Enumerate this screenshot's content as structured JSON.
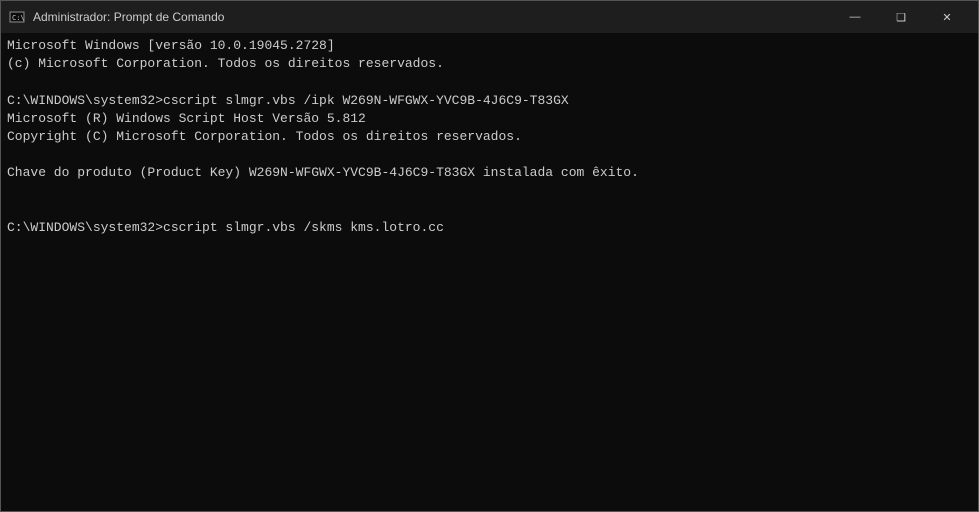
{
  "window": {
    "title": "Administrador: Prompt de Comando"
  },
  "titlebar": {
    "minimize_label": "—",
    "maximize_label": "❑",
    "close_label": "✕"
  },
  "console": {
    "lines": [
      "Microsoft Windows [versão 10.0.19045.2728]",
      "(c) Microsoft Corporation. Todos os direitos reservados.",
      "",
      "C:\\WINDOWS\\system32>cscript slmgr.vbs /ipk W269N-WFGWX-YVC9B-4J6C9-T83GX",
      "Microsoft (R) Windows Script Host Versão 5.812",
      "Copyright (C) Microsoft Corporation. Todos os direitos reservados.",
      "",
      "Chave do produto (Product Key) W269N-WFGWX-YVC9B-4J6C9-T83GX instalada com êxito.",
      "",
      "",
      "C:\\WINDOWS\\system32>cscript slmgr.vbs /skms kms.lotro.cc"
    ]
  }
}
